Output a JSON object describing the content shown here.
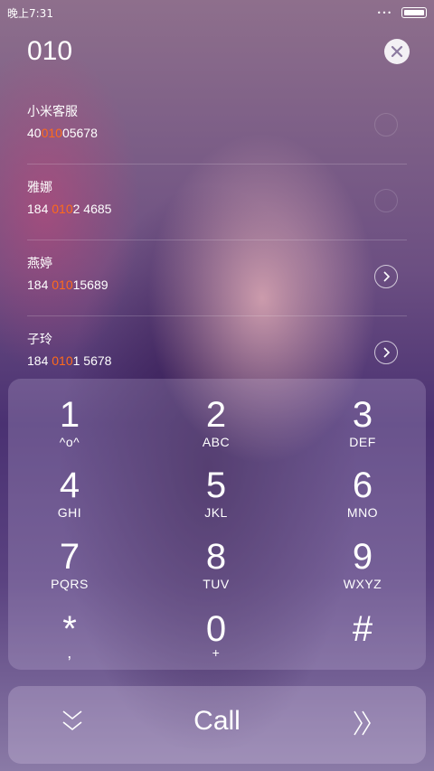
{
  "status": {
    "time": "晚上7:31",
    "dots": "•••"
  },
  "dialer": {
    "input": "010"
  },
  "contacts": [
    {
      "name": "小米客服",
      "num_pre": "40",
      "num_hl": "010",
      "num_post": "05678"
    },
    {
      "name": "雅娜",
      "num_pre": "184 ",
      "num_hl": "010",
      "num_post": "2 4685"
    },
    {
      "name": "燕婷",
      "num_pre": "184 ",
      "num_hl": "010",
      "num_post": "15689"
    },
    {
      "name": "子玲",
      "num_pre": "184 ",
      "num_hl": "010",
      "num_post": "1 5678"
    }
  ],
  "keys": [
    {
      "digit": "1",
      "letters": "^o^"
    },
    {
      "digit": "2",
      "letters": "ABC"
    },
    {
      "digit": "3",
      "letters": "DEF"
    },
    {
      "digit": "4",
      "letters": "GHI"
    },
    {
      "digit": "5",
      "letters": "JKL"
    },
    {
      "digit": "6",
      "letters": "MNO"
    },
    {
      "digit": "7",
      "letters": "PQRS"
    },
    {
      "digit": "8",
      "letters": "TUV"
    },
    {
      "digit": "9",
      "letters": "WXYZ"
    },
    {
      "digit": "*",
      "letters": ","
    },
    {
      "digit": "0",
      "letters": "+"
    },
    {
      "digit": "#",
      "letters": ""
    }
  ],
  "call": {
    "label": "Call"
  },
  "colors": {
    "highlight": "#ff6a1a"
  },
  "icons": [
    "close-icon",
    "chevron-right-icon",
    "chevron-down-icon",
    "double-chevron-right-icon",
    "battery-icon"
  ]
}
